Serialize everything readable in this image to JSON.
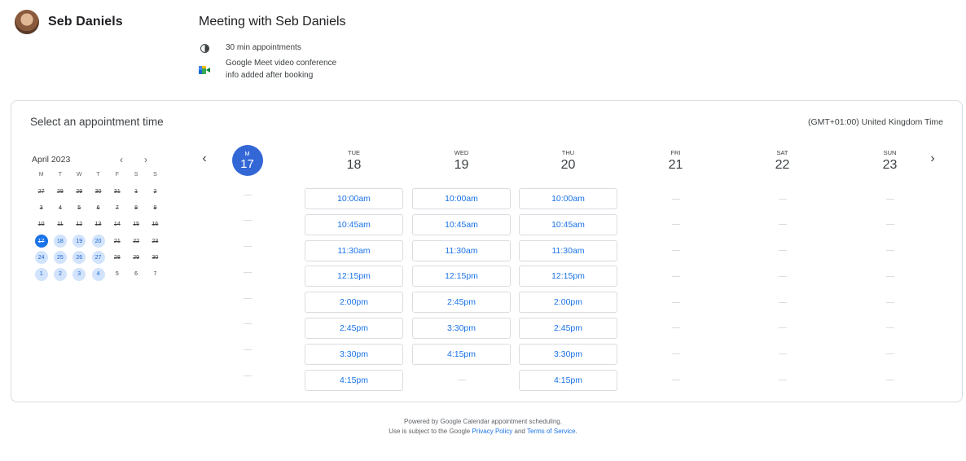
{
  "host": {
    "name": "Seb Daniels"
  },
  "meeting": {
    "title": "Meeting with Seb Daniels",
    "duration": "30 min appointments",
    "conference_line1": "Google Meet video conference",
    "conference_line2": "info added after booking"
  },
  "card": {
    "title": "Select an appointment time",
    "timezone": "(GMT+01:00) United Kingdom Time"
  },
  "mini_calendar": {
    "month": "April 2023",
    "prev": "‹",
    "next": "›",
    "weekdays": [
      "M",
      "T",
      "W",
      "T",
      "F",
      "S",
      "S"
    ],
    "days": [
      {
        "n": "27",
        "s": "past"
      },
      {
        "n": "28",
        "s": "past"
      },
      {
        "n": "29",
        "s": "past"
      },
      {
        "n": "30",
        "s": "past"
      },
      {
        "n": "31",
        "s": "past"
      },
      {
        "n": "1",
        "s": "past"
      },
      {
        "n": "2",
        "s": "past"
      },
      {
        "n": "3",
        "s": "past"
      },
      {
        "n": "4",
        "s": "past"
      },
      {
        "n": "5",
        "s": "past"
      },
      {
        "n": "6",
        "s": "past"
      },
      {
        "n": "7",
        "s": "past"
      },
      {
        "n": "8",
        "s": "past"
      },
      {
        "n": "9",
        "s": "past"
      },
      {
        "n": "10",
        "s": "past"
      },
      {
        "n": "11",
        "s": "past"
      },
      {
        "n": "12",
        "s": "past"
      },
      {
        "n": "13",
        "s": "past"
      },
      {
        "n": "14",
        "s": "past"
      },
      {
        "n": "15",
        "s": "past"
      },
      {
        "n": "16",
        "s": "past"
      },
      {
        "n": "17",
        "s": "sel"
      },
      {
        "n": "18",
        "s": "avail"
      },
      {
        "n": "19",
        "s": "avail"
      },
      {
        "n": "20",
        "s": "avail"
      },
      {
        "n": "21",
        "s": "past"
      },
      {
        "n": "22",
        "s": "past"
      },
      {
        "n": "23",
        "s": "past"
      },
      {
        "n": "24",
        "s": "avail"
      },
      {
        "n": "25",
        "s": "avail"
      },
      {
        "n": "26",
        "s": "avail"
      },
      {
        "n": "27",
        "s": "avail"
      },
      {
        "n": "28",
        "s": "past"
      },
      {
        "n": "29",
        "s": "past"
      },
      {
        "n": "30",
        "s": "past"
      },
      {
        "n": "1",
        "s": "avail"
      },
      {
        "n": "2",
        "s": "avail"
      },
      {
        "n": "3",
        "s": "avail"
      },
      {
        "n": "4",
        "s": "avail"
      },
      {
        "n": "5",
        "s": "none"
      },
      {
        "n": "6",
        "s": "none"
      },
      {
        "n": "7",
        "s": "none"
      }
    ]
  },
  "week_nav": {
    "prev": "‹",
    "next": "›"
  },
  "week": [
    {
      "dow": "M",
      "date": "17",
      "today": true,
      "slots": [
        "",
        "",
        "",
        "",
        "",
        "",
        "",
        ""
      ]
    },
    {
      "dow": "TUE",
      "date": "18",
      "today": false,
      "slots": [
        "10:00am",
        "10:45am",
        "11:30am",
        "12:15pm",
        "2:00pm",
        "2:45pm",
        "3:30pm",
        "4:15pm"
      ]
    },
    {
      "dow": "WED",
      "date": "19",
      "today": false,
      "slots": [
        "10:00am",
        "10:45am",
        "11:30am",
        "12:15pm",
        "2:45pm",
        "3:30pm",
        "4:15pm",
        ""
      ]
    },
    {
      "dow": "THU",
      "date": "20",
      "today": false,
      "slots": [
        "10:00am",
        "10:45am",
        "11:30am",
        "12:15pm",
        "2:00pm",
        "2:45pm",
        "3:30pm",
        "4:15pm"
      ]
    },
    {
      "dow": "FRI",
      "date": "21",
      "today": false,
      "slots": [
        "",
        "",
        "",
        "",
        "",
        "",
        "",
        ""
      ]
    },
    {
      "dow": "SAT",
      "date": "22",
      "today": false,
      "slots": [
        "",
        "",
        "",
        "",
        "",
        "",
        "",
        ""
      ]
    },
    {
      "dow": "SUN",
      "date": "23",
      "today": false,
      "slots": [
        "",
        "",
        "",
        "",
        "",
        "",
        "",
        ""
      ]
    }
  ],
  "footer": {
    "line1": "Powered by Google Calendar appointment scheduling.",
    "line2_prefix": "Use is subject to the Google",
    "privacy": "Privacy Policy",
    "and": "and",
    "terms": "Terms of Service",
    "period": "."
  },
  "colors": {
    "accent": "#1a73e8",
    "selected_day": "#3367d6",
    "available_day": "#d2e3fc",
    "border": "#dadce0"
  }
}
